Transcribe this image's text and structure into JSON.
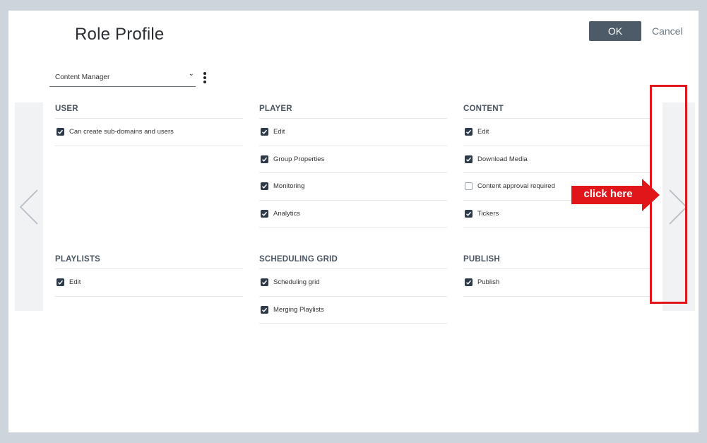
{
  "dialog": {
    "title": "Role Profile",
    "ok_label": "OK",
    "cancel_label": "Cancel"
  },
  "role_select": {
    "value": "Content Manager"
  },
  "callout": {
    "text": "click here",
    "color": "#e0161b"
  },
  "colors": {
    "accent": "#2e3a4a",
    "ok_button": "#4d5b69",
    "highlight": "#e0161b"
  },
  "sections": [
    {
      "title": "USER",
      "permissions": [
        {
          "label": "Can create sub-domains and users",
          "checked": true
        }
      ]
    },
    {
      "title": "PLAYER",
      "permissions": [
        {
          "label": "Edit",
          "checked": true
        },
        {
          "label": "Group Properties",
          "checked": true
        },
        {
          "label": "Monitoring",
          "checked": true
        },
        {
          "label": "Analytics",
          "checked": true
        }
      ]
    },
    {
      "title": "CONTENT",
      "permissions": [
        {
          "label": "Edit",
          "checked": true
        },
        {
          "label": "Download Media",
          "checked": true
        },
        {
          "label": "Content approval required",
          "checked": false
        },
        {
          "label": "Tickers",
          "checked": true
        }
      ]
    },
    {
      "title": "PLAYLISTS",
      "permissions": [
        {
          "label": "Edit",
          "checked": true
        }
      ]
    },
    {
      "title": "SCHEDULING GRID",
      "permissions": [
        {
          "label": "Scheduling grid",
          "checked": true
        },
        {
          "label": "Merging Playlists",
          "checked": true
        }
      ]
    },
    {
      "title": "PUBLISH",
      "permissions": [
        {
          "label": "Publish",
          "checked": true
        }
      ]
    }
  ]
}
